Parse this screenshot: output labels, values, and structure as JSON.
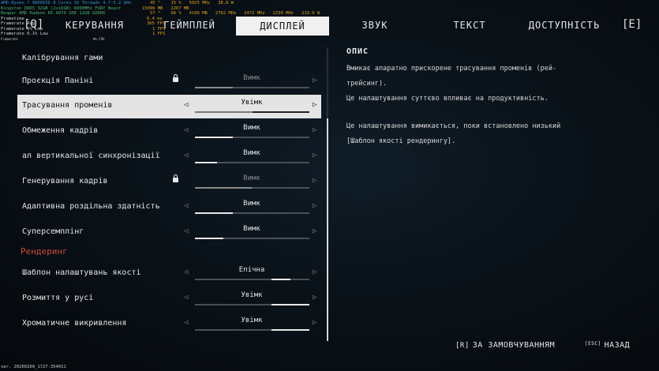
{
  "overlay": {
    "cpu": "AMD Ryzen 7 9800X3D 8 Cores 16 Threads 4.7-5.2 GHz",
    "cpu_vals": "45 °    15 %   5025 MHz   38.8 W",
    "ram": "Kingston DDR5 32GB (2x16GB) 6000MHz FURY Beast",
    "ram_vals": "15096 MB   2207 MB",
    "gpu": "Reaper AMD Radeon RX 9070 GRE 12GB GDDR6",
    "gpu_vals": "57 °    66 %   4106 MB   2702 MHz   2472 MHz   2230 MHz   219.0 W",
    "frametime": "Frametime",
    "frametime_val": "6.4 ms",
    "framerate": "Framerate Avg",
    "framerate_val": "365 FPS",
    "low1": "Framerate 1% Low",
    "low1_val": "1 FPS",
    "low01": "Framerate 0.1% Low",
    "low01_val": "1 FPS",
    "frame_extra": "Framerate",
    "frame_extra_val": "0% CPU"
  },
  "tabs": {
    "q": "[Q]",
    "controls": "КЕРУВАННЯ",
    "gameplay": "ГЕЙМПЛЕЙ",
    "display": "ДИСПЛЕЙ",
    "sound": "ЗВУК",
    "text": "ТЕКСТ",
    "accessibility": "ДОСТУПНІСТЬ",
    "e": "[E]"
  },
  "settings": {
    "calibration": "Калібрування гами",
    "panini": {
      "label": "Проєкція Паніні",
      "value": "Вимк"
    },
    "raytracing": {
      "label": "Трасування променів",
      "value": "Увімк"
    },
    "framelimit": {
      "label": "Обмеження кадрів",
      "value": "Вимк"
    },
    "vsync": {
      "label": "ал вертикальної синхронізації",
      "value": "Вимк"
    },
    "framegen": {
      "label": "Генерування кадрів",
      "value": "Вимк"
    },
    "adaptive": {
      "label": "Адаптивна роздільна здатність",
      "value": "Вимк"
    },
    "supersampling": {
      "label": "Суперсемплінг",
      "value": "Вимк"
    },
    "rendering_section": "Рендеринг",
    "quality": {
      "label": "Шаблон налаштувань якості",
      "value": "Епічна"
    },
    "motionblur": {
      "label": "Розмиття у русі",
      "value": "Увімк"
    },
    "chromatic": {
      "label": "Хроматичне викривлення",
      "value": "Увімк"
    }
  },
  "description": {
    "title": "ОПИС",
    "line1": "Вмикає апаратно прискорене трасування променів (рей-",
    "line2": "трейсинг).",
    "line3": "Це налаштування суттєво впливає на продуктивність.",
    "line4": "Це налаштування вимикається, поки встановлено низький",
    "line5": "[Шаблон якості рендерингу]."
  },
  "footer": {
    "reset_key": "[R]",
    "reset_label": "ЗА ЗАМОВЧУВАННЯМ",
    "back_key": "[ESC]",
    "back_label": "НАЗАД",
    "version": "ver. 20260209_1727-354011"
  }
}
